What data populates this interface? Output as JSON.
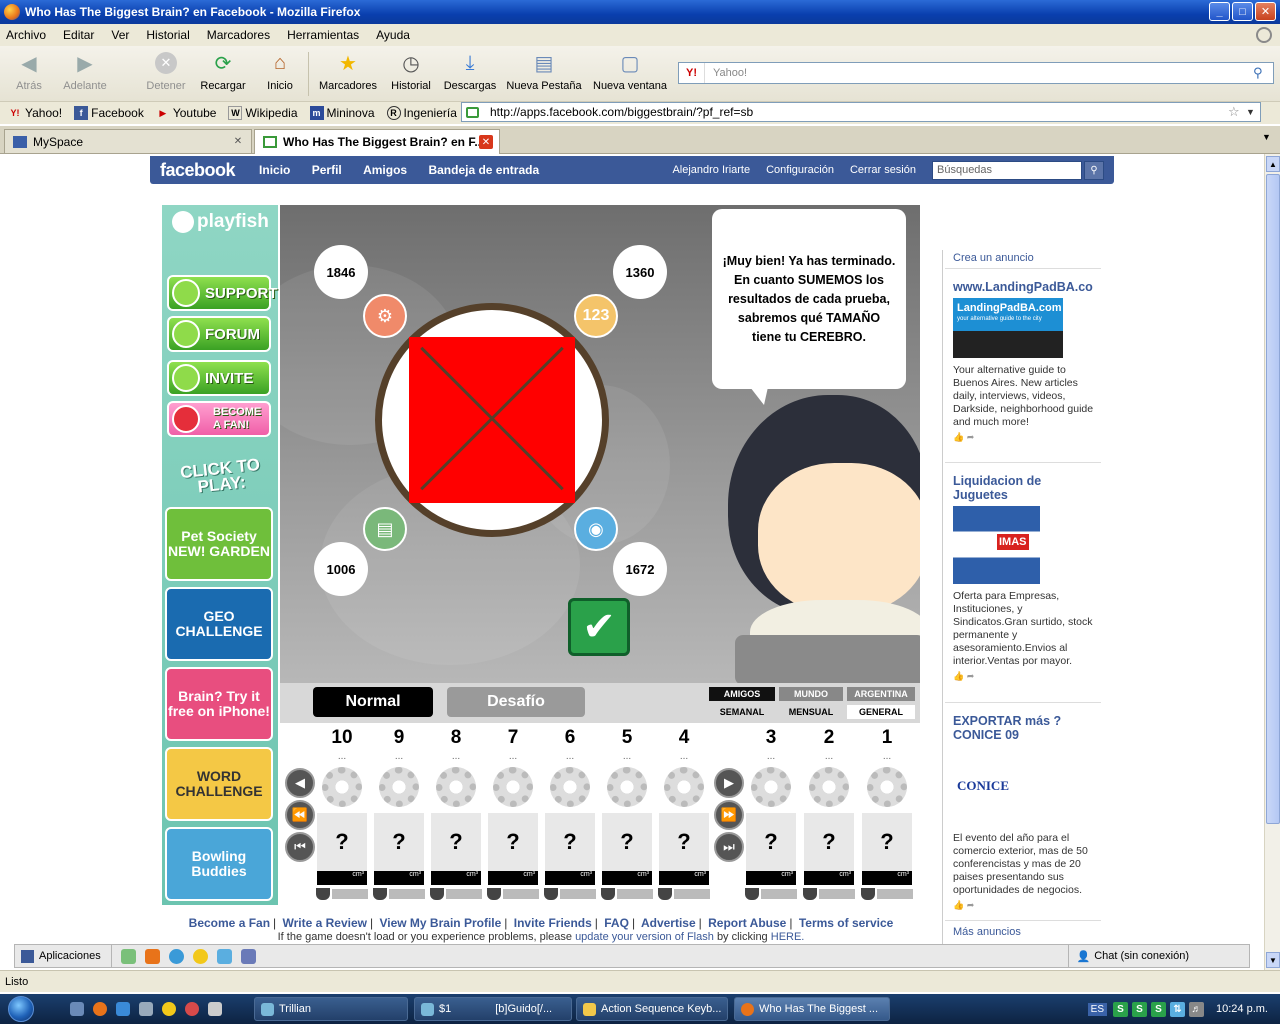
{
  "window": {
    "title": "Who Has The Biggest Brain? en Facebook - Mozilla Firefox",
    "min": "_",
    "max": "□",
    "close": "✕"
  },
  "menu": [
    "Archivo",
    "Editar",
    "Ver",
    "Historial",
    "Marcadores",
    "Herramientas",
    "Ayuda"
  ],
  "toolbar": {
    "back": "Atrás",
    "forward": "Adelante",
    "stop": "Detener",
    "reload": "Recargar",
    "home": "Inicio",
    "bookmarks": "Marcadores",
    "history": "Historial",
    "downloads": "Descargas",
    "new_tab": "Nueva Pestaña",
    "new_window": "Nueva ventana",
    "search_placeholder": "Yahoo!"
  },
  "bookmarks": [
    "Yahoo!",
    "Facebook",
    "Youtube",
    "Wikipedia",
    "Mininova",
    "Ingeniería UNLP"
  ],
  "url": "http://apps.facebook.com/biggestbrain/?pf_ref=sb",
  "tabs": [
    {
      "label": "MySpace"
    },
    {
      "label": "Who Has The Biggest Brain? en F..."
    }
  ],
  "facebook": {
    "logo": "facebook",
    "nav": [
      "Inicio",
      "Perfil",
      "Amigos",
      "Bandeja de entrada"
    ],
    "user": "Alejandro Iriarte",
    "settings": "Configuración",
    "logout": "Cerrar sesión",
    "search_placeholder": "Búsquedas"
  },
  "playfish": {
    "logo": "playfish",
    "buttons": [
      "SUPPORT",
      "FORUM",
      "INVITE",
      "BECOME A FAN!"
    ],
    "click_to_play": "CLICK TO PLAY:",
    "games": [
      {
        "label": "Pet Society NEW! GARDEN",
        "color": "#6fbf3b"
      },
      {
        "label": "GEO CHALLENGE",
        "color": "#1a6bb0"
      },
      {
        "label": "Brain? Try it free on iPhone!",
        "color": "#e84e7f"
      },
      {
        "label": "WORD CHALLENGE",
        "color": "#f4c845"
      },
      {
        "label": "Bowling Buddies",
        "color": "#4aa6d8"
      }
    ]
  },
  "game": {
    "scores": {
      "top_left": "1846",
      "top_right": "1360",
      "bottom_left": "1006",
      "bottom_right": "1672"
    },
    "icon_123": "123",
    "speech": "¡Muy bien! Ya has terminado. En cuanto SUMEMOS los resultados de cada prueba, sabremos qué TAMAÑO tiene tu CEREBRO.",
    "modes": {
      "normal": "Normal",
      "challenge": "Desafío"
    },
    "filters": {
      "friends": "AMIGOS",
      "world": "MUNDO",
      "country": "ARGENTINA"
    },
    "periods": {
      "weekly": "SEMANAL",
      "monthly": "MENSUAL",
      "general": "GENERAL"
    },
    "ranks": [
      "10",
      "9",
      "8",
      "7",
      "6",
      "5",
      "4",
      "3",
      "2",
      "1"
    ],
    "dots": "...",
    "unknown": "?",
    "unit": "cm³"
  },
  "footer": {
    "links": [
      "Become a Fan",
      "Write a Review",
      "View My Brain Profile",
      "Invite Friends",
      "FAQ",
      "Advertise",
      "Report Abuse",
      "Terms of service"
    ],
    "note_before": "If the game doesn't load or you experience problems, please",
    "note_link": "update your version of Flash",
    "note_mid": "by clicking",
    "note_here": "HERE."
  },
  "ads": {
    "create": "Crea un anuncio",
    "items": [
      {
        "title": "www.LandingPadBA.co",
        "img_text": "LandingPadBA.com",
        "img_sub": "your alternative guide to the city",
        "text": "Your alternative guide to Buenos Aires. New articles daily, interviews, videos, Darkside, neighborhood guide and much more!"
      },
      {
        "title": "Liquidacion de Juguetes",
        "img_text": "IMAS",
        "text": "Oferta para Empresas, Instituciones, y Sindicatos.Gran surtido, stock permanente y asesoramiento.Envios al interior.Ventas por mayor."
      },
      {
        "title": "EXPORTAR más ? CONICE 09",
        "img_text": "CONICE",
        "text": "El evento del año para el comercio exterior, mas de 50 conferencistas y mas de 20 paises presentando sus oportunidades de negocios."
      }
    ],
    "more": "Más anuncios"
  },
  "fb_bottom": {
    "apps": "Aplicaciones",
    "chat": "Chat (sin conexión)"
  },
  "status": "Listo",
  "taskbar": {
    "items": [
      "Trillian",
      "$1",
      "[b]Guido[/...",
      "Action Sequence Keyb...",
      "Who Has The Biggest ..."
    ],
    "lang": "ES",
    "clock": "10:24 p.m."
  }
}
